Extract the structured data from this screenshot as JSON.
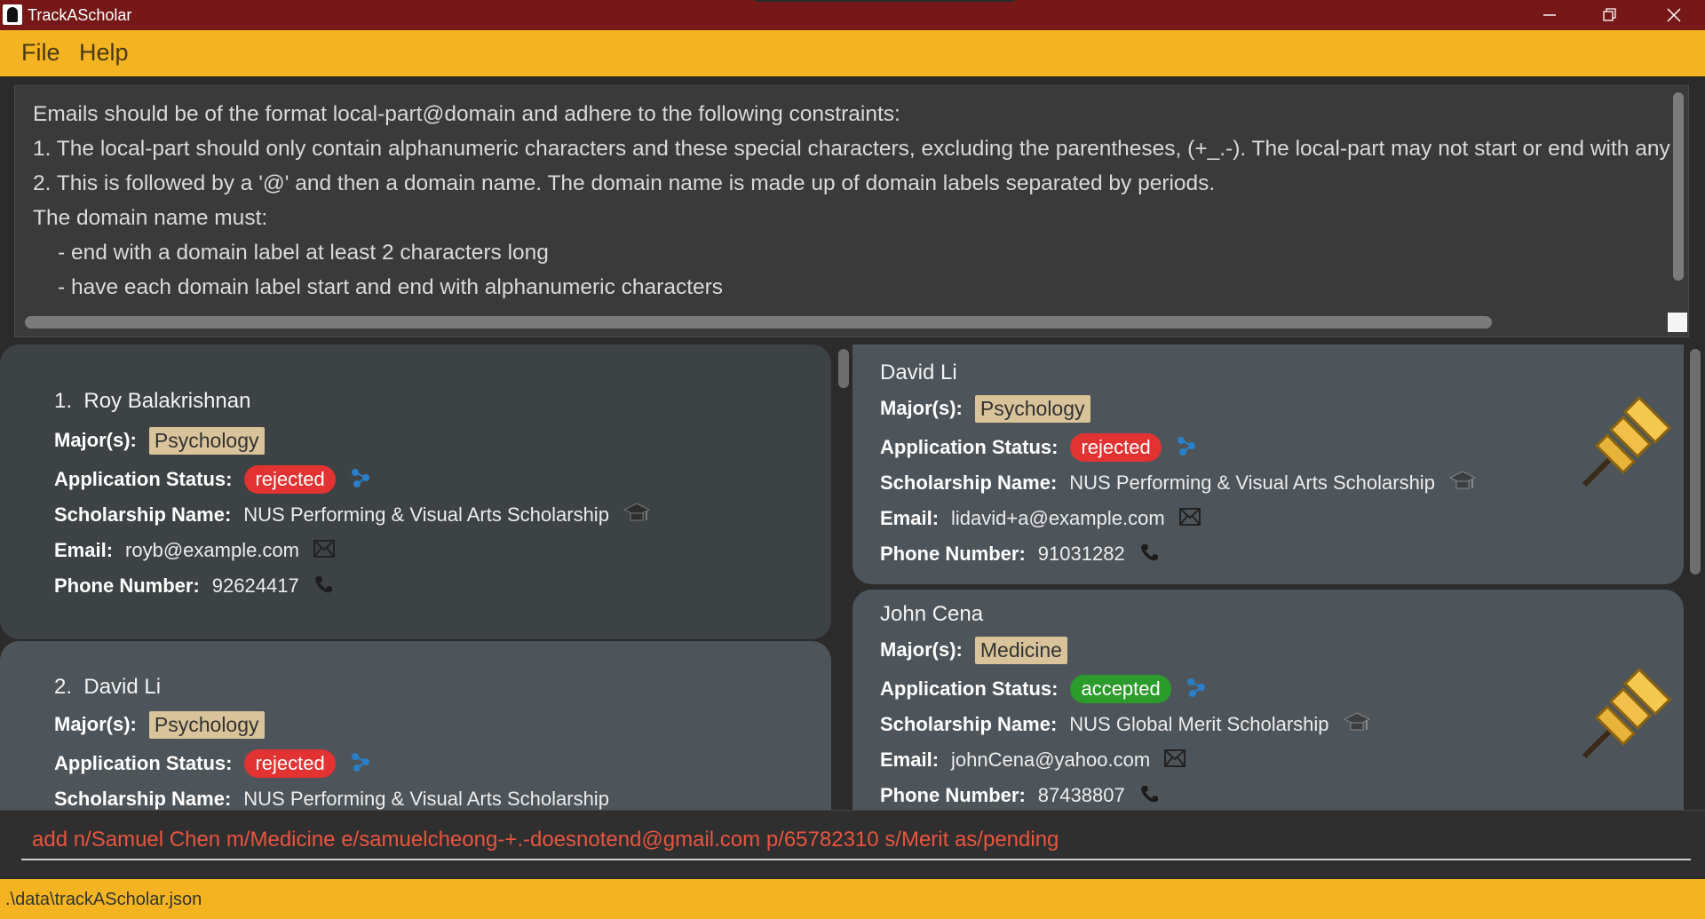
{
  "window": {
    "title": "TrackAScholar",
    "minimize": "—",
    "restore": "❐",
    "close": "✕"
  },
  "menu": {
    "file": "File",
    "help": "Help"
  },
  "result": {
    "lines": [
      "Emails should be of the format local-part@domain and adhere to the following constraints:",
      "1. The local-part should only contain alphanumeric characters and these special characters, excluding the parentheses, (+_.-). The local-part may not start or end with any",
      "2. This is followed by a '@' and then a domain name. The domain name is made up of domain labels separated by periods.",
      "The domain name must:",
      "- end with a domain label at least 2 characters long",
      "- have each domain label start and end with alphanumeric characters"
    ]
  },
  "labels": {
    "major": "Major(s):",
    "status": "Application Status:",
    "scholarship": "Scholarship Name:",
    "email": "Email:",
    "phone": "Phone Number:"
  },
  "applicants": [
    {
      "index": "1.",
      "name": "Roy Balakrishnan",
      "major": "Psychology",
      "status": "rejected",
      "scholarship": "NUS Performing & Visual Arts Scholarship",
      "email": "royb@example.com",
      "phone": "92624417"
    },
    {
      "index": "2.",
      "name": "David Li",
      "major": "Psychology",
      "status": "rejected",
      "scholarship": "NUS Performing & Visual Arts Scholarship"
    }
  ],
  "pinned": [
    {
      "name": "David Li",
      "major": "Psychology",
      "status": "rejected",
      "scholarship": "NUS Performing & Visual Arts Scholarship",
      "email": "lidavid+a@example.com",
      "phone": "91031282"
    },
    {
      "name": "John Cena",
      "major": "Medicine",
      "status": "accepted",
      "scholarship": "NUS Global Merit Scholarship",
      "email": "johnCena@yahoo.com",
      "phone": "87438807"
    }
  ],
  "command": {
    "value": "add n/Samuel Chen m/Medicine e/samuelcheong-+.-doesnotend@gmail.com p/65782310 s/Merit as/pending"
  },
  "statusbar": {
    "path": ".\\data\\trackAScholar.json"
  },
  "colors": {
    "titlebar": "#761818",
    "menubar": "#f4b421",
    "rejected": "#e23232",
    "accepted": "#2b9b2b",
    "command_text": "#e8543f"
  }
}
